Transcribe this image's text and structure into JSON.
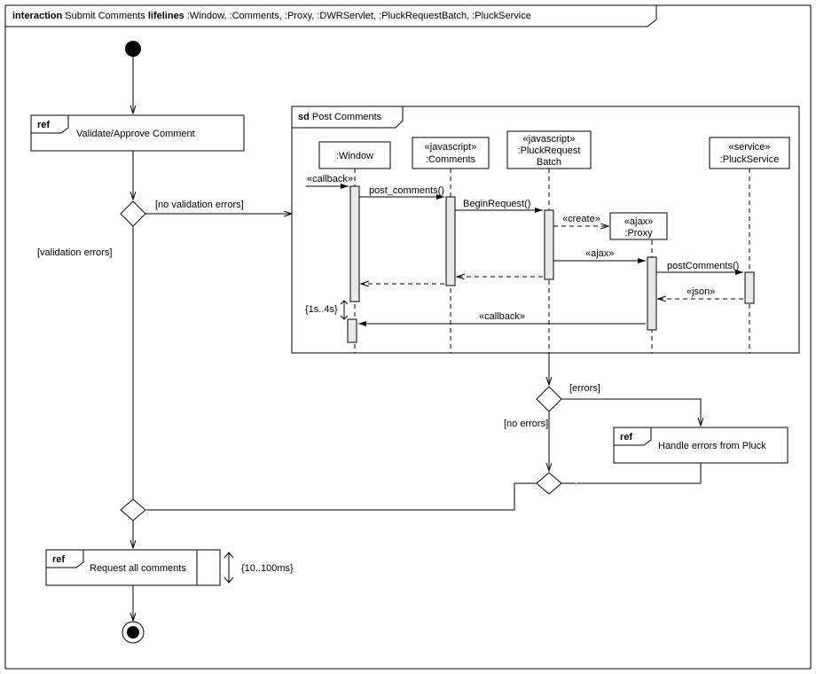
{
  "frame": {
    "interaction_kw": "interaction",
    "interaction_name": "Submit Comments",
    "lifelines_kw": "lifelines",
    "lifelines_list": " :Window, :Comments, :Proxy, :DWRServlet, :PluckRequestBatch, :PluckService"
  },
  "refs": {
    "validate": "Validate/Approve Comment",
    "request_all": "Request all comments",
    "handle_errors": "Handle errors from Pluck",
    "ref_kw": "ref"
  },
  "sd": {
    "kw": "sd",
    "name": "Post Comments",
    "lifeline_window": ":Window",
    "lifeline_comments": ":Comments",
    "lifeline_pluckbatch": ":PluckRequest",
    "lifeline_pluckbatch2": "Batch",
    "lifeline_proxy": ":Proxy",
    "lifeline_pluckservice": ":PluckService",
    "st_js": "«javascript»",
    "st_ajax": "«ajax»",
    "st_service": "«service»",
    "msg_callback": "«callback»",
    "msg_post": "post_comments()",
    "msg_begin": "BeginRequest()",
    "msg_create": "«create»",
    "msg_ajax": "«ajax»",
    "msg_postcomments": "postComments()",
    "msg_json": "«json»",
    "msg_callback2": "«callback»",
    "constraint_time": "{1s..4s}"
  },
  "guards": {
    "no_validation": "[no validation errors]",
    "validation": "[validation errors]",
    "errors": "[errors]",
    "no_errors": "[no errors]"
  },
  "constraints": {
    "request_time": "{10..100ms}"
  }
}
